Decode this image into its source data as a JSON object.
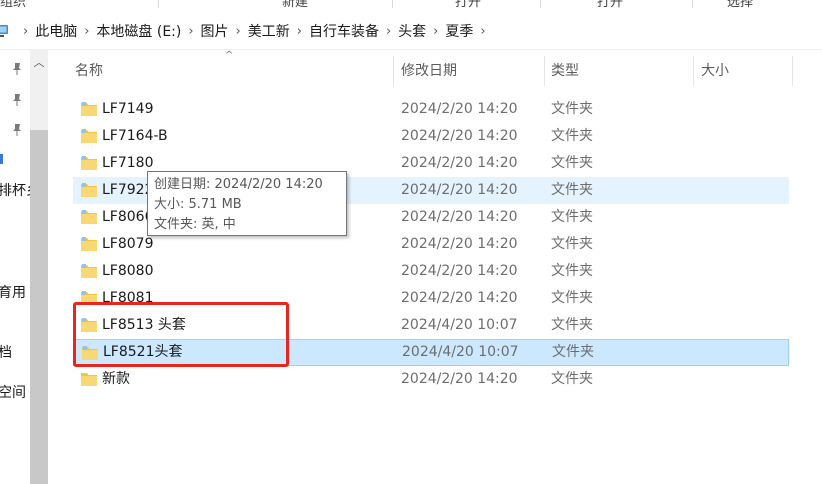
{
  "ribbon": {
    "labels": [
      "组织",
      "新建",
      "打开",
      "选择"
    ]
  },
  "breadcrumb": [
    "此电脑",
    "本地磁盘 (E:)",
    "图片",
    "美工新",
    "自行车装备",
    "头套",
    "夏季"
  ],
  "nav": {
    "fragments": [
      "排杯乡",
      "育用",
      "档",
      "空间"
    ]
  },
  "columns": {
    "name": "名称",
    "date": "修改日期",
    "type": "类型",
    "size": "大小"
  },
  "files": [
    {
      "name": "LF7149",
      "date": "2024/2/20 14:20",
      "type": "文件夹"
    },
    {
      "name": "LF7164-B",
      "date": "2024/2/20 14:20",
      "type": "文件夹"
    },
    {
      "name": "LF7180",
      "date": "2024/2/20 14:20",
      "type": "文件夹"
    },
    {
      "name": "LF7922",
      "date": "2024/2/20 14:20",
      "type": "文件夹"
    },
    {
      "name": "LF8066",
      "date": "2024/2/20 14:20",
      "type": "文件夹"
    },
    {
      "name": "LF8079",
      "date": "2024/2/20 14:20",
      "type": "文件夹"
    },
    {
      "name": "LF8080",
      "date": "2024/2/20 14:20",
      "type": "文件夹"
    },
    {
      "name": "LF8081",
      "date": "2024/2/20 14:20",
      "type": "文件夹"
    },
    {
      "name": "LF8513 头套",
      "date": "2024/4/20 10:07",
      "type": "文件夹"
    },
    {
      "name": "LF8521头套",
      "date": "2024/4/20 10:07",
      "type": "文件夹"
    },
    {
      "name": "新款",
      "date": "2024/2/20 14:20",
      "type": "文件夹"
    }
  ],
  "tooltip": {
    "created": "创建日期: 2024/2/20 14:20",
    "size": "大小: 5.71 MB",
    "folders": "文件夹: 英, 中"
  },
  "colors": {
    "selected_bg": "#cce8ff",
    "hover_bg": "#e5f3ff",
    "annotation": "#e8261d",
    "folder": "#f4c542"
  }
}
